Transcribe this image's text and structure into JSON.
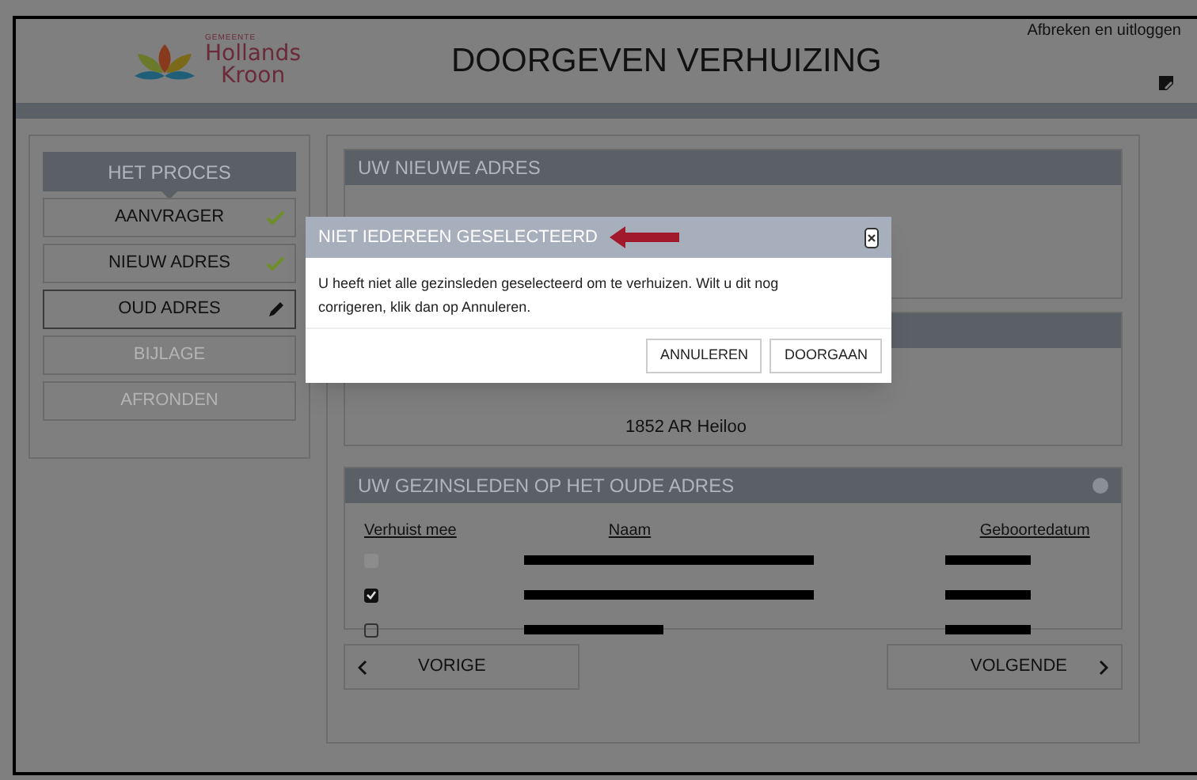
{
  "header": {
    "logo_small": "GEMEENTE",
    "logo_line1": "Hollands",
    "logo_line2": "Kroon",
    "title": "DOORGEVEN VERHUIZING",
    "logout": "Afbreken en uitloggen"
  },
  "process": {
    "title": "HET PROCES",
    "steps": [
      {
        "label": "AANVRAGER",
        "completed": true,
        "current": false,
        "disabled": false
      },
      {
        "label": "NIEUW ADRES",
        "completed": true,
        "current": false,
        "disabled": false
      },
      {
        "label": "OUD ADRES",
        "completed": false,
        "current": true,
        "disabled": false
      },
      {
        "label": "BIJLAGE",
        "completed": false,
        "current": false,
        "disabled": true
      },
      {
        "label": "AFRONDEN",
        "completed": false,
        "current": false,
        "disabled": true
      }
    ]
  },
  "new_address": {
    "title": "UW NIEUWE ADRES"
  },
  "old_address": {
    "city_line": "1852 AR Heiloo"
  },
  "members": {
    "title": "UW GEZINSLEDEN OP HET OUDE ADRES",
    "columns": [
      "Verhuist mee",
      "Naam",
      "Geboortedatum"
    ],
    "rows": [
      {
        "checked": false,
        "disabled": true
      },
      {
        "checked": true,
        "disabled": false
      },
      {
        "checked": false,
        "disabled": false
      }
    ]
  },
  "nav": {
    "prev": "VORIGE",
    "next": "VOLGENDE"
  },
  "dialog": {
    "title": "NIET IEDEREEN GESELECTEERD",
    "message": "U heeft niet alle gezinsleden geselecteerd om te verhuizen. Wilt u dit nog corrigeren, klik dan op Annuleren.",
    "buttons": [
      "ANNULEREN",
      "DOORGAAN"
    ]
  }
}
